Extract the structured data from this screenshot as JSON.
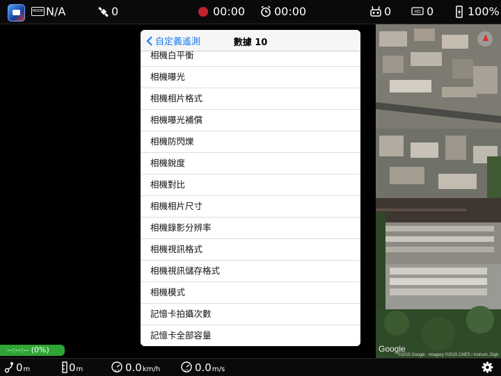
{
  "status": {
    "mode_icon_label": "MODE",
    "mode_value": "N/A",
    "satellite_count": "0",
    "record_time": "00:00",
    "timer_time": "00:00",
    "rc_signal": "0",
    "hd_signal": "0",
    "battery": "100%"
  },
  "popover": {
    "back_label": "自定義遙測",
    "title": "數據 10",
    "items": [
      "相機白平衡",
      "相機曝光",
      "相機相片格式",
      "相機曝光補償",
      "相機防閃爍",
      "相機銳度",
      "相機對比",
      "相機相片尺寸",
      "相機錄影分辨率",
      "相機視訊格式",
      "相機視訊儲存格式",
      "相機模式",
      "記憶卡拍攝次數",
      "記憶卡全部容量"
    ]
  },
  "progress": {
    "label": "--:--:-- (0%)"
  },
  "map": {
    "logo": "Google",
    "attribution": "©2015 Google - Imagery ©2015 CNES / Astrium, Digit"
  },
  "telemetry": {
    "distance": "0",
    "distance_unit": "m",
    "altitude": "0",
    "altitude_unit": "m",
    "h_speed": "0.0",
    "h_speed_unit": "km/h",
    "v_speed": "0.0",
    "v_speed_unit": "m/s"
  },
  "colors": {
    "accent": "#1b7cf0",
    "record": "#c0242c",
    "progress": "#2fa535"
  }
}
